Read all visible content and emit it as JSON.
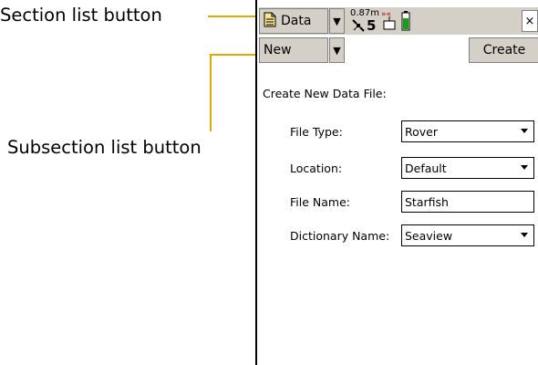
{
  "callouts": {
    "section": "Section list button",
    "subsection": "Subsection list button"
  },
  "top_bar": {
    "section_label": "Data",
    "status_distance": "0.87m",
    "status_sats": "5",
    "close_label": "×"
  },
  "sub_bar": {
    "subsection_label": "New",
    "create_label": "Create"
  },
  "form": {
    "heading": "Create New Data File:",
    "fields": [
      {
        "label": "File Type:",
        "value": "Rover",
        "type": "select"
      },
      {
        "label": "Location:",
        "value": "Default",
        "type": "select"
      },
      {
        "label": "File Name:",
        "value": "Starfish",
        "type": "text"
      },
      {
        "label": "Dictionary Name:",
        "value": "Seaview",
        "type": "select"
      }
    ]
  },
  "colors": {
    "callout_line": "#e0a800",
    "toolbar_bg": "#d4d0c8"
  }
}
